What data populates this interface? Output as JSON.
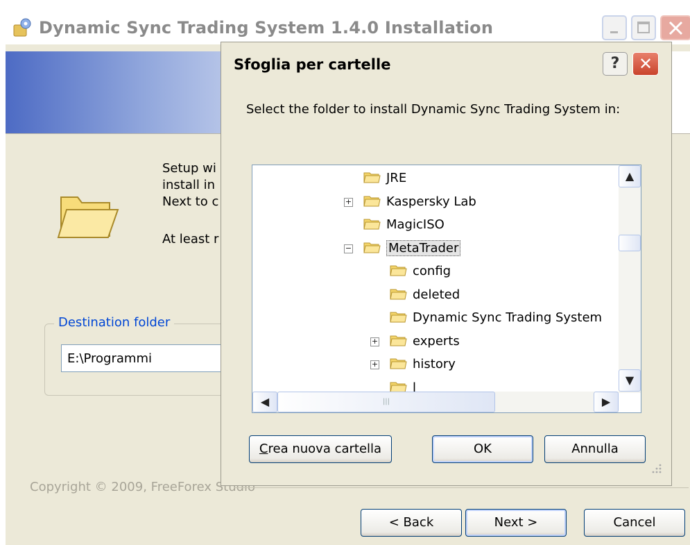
{
  "main_window": {
    "title": "Dynamic Sync Trading System 1.4.0 Installation",
    "intro_lines": [
      "Setup wi",
      "install in",
      "Next to c",
      "At least r"
    ],
    "destination_folder_label": "Destination folder",
    "destination_folder_value": "E:\\Programmi",
    "copyright": "Copyright © 2009, FreeForex Studio",
    "buttons": {
      "back": "< Back",
      "next": "Next >",
      "cancel": "Cancel"
    }
  },
  "dialog": {
    "title": "Sfoglia per cartelle",
    "help_label": "?",
    "close_label": "✕",
    "prompt": "Select the folder to install Dynamic Sync Trading System in:",
    "tree": [
      {
        "label": "JRE",
        "expander": ""
      },
      {
        "label": "Kaspersky Lab",
        "expander": "+"
      },
      {
        "label": "MagicISO",
        "expander": ""
      },
      {
        "label": "MetaTrader",
        "expander": "−",
        "selected": true
      },
      {
        "label": "config",
        "expander": ""
      },
      {
        "label": "deleted",
        "expander": ""
      },
      {
        "label": "Dynamic Sync Trading System",
        "expander": ""
      },
      {
        "label": "experts",
        "expander": "+"
      },
      {
        "label": "history",
        "expander": "+"
      },
      {
        "label": "l",
        "expander": ""
      }
    ],
    "buttons": {
      "new_folder": "Crea nuova cartella",
      "ok": "OK",
      "cancel": "Annulla"
    }
  },
  "icons": {
    "scroll_up": "▲",
    "scroll_down": "▼",
    "scroll_left": "◀",
    "scroll_right": "▶",
    "thumb_grip": "|||"
  },
  "colors": {
    "window_bg": "#ece9d8",
    "header_gradient_start": "#4d6bc4",
    "accent_blue": "#0046d5",
    "close_red": "#d9553d"
  }
}
